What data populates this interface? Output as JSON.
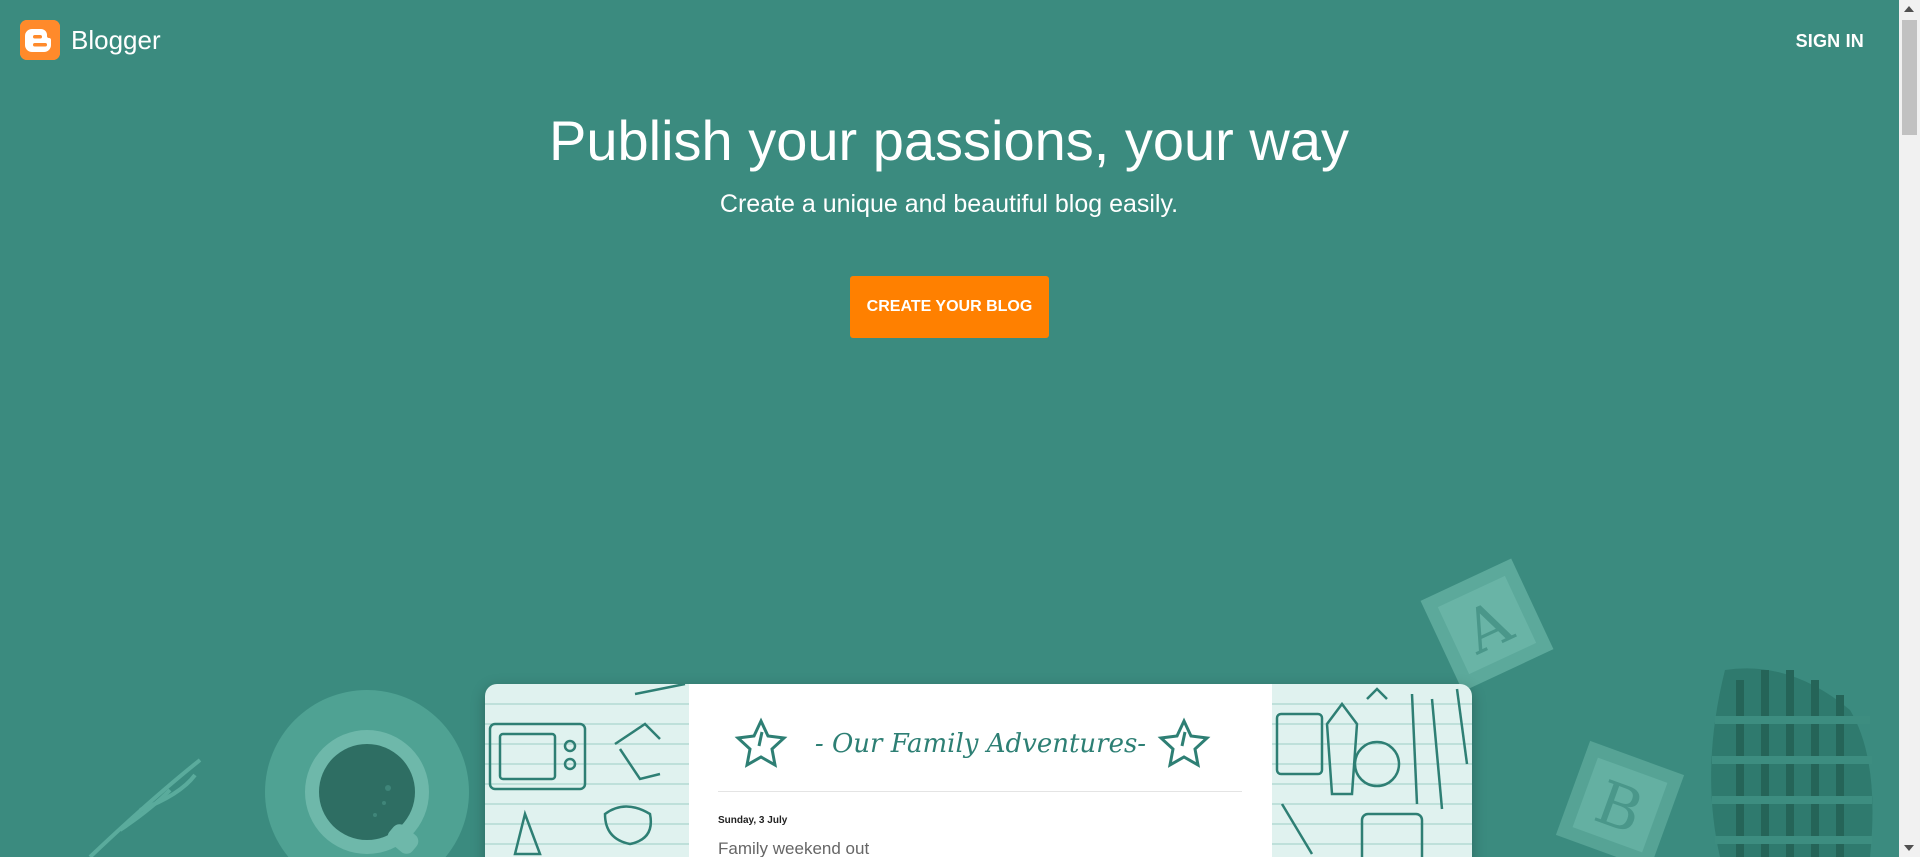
{
  "header": {
    "brand": "Blogger",
    "sign_in": "SIGN IN"
  },
  "hero": {
    "title": "Publish your passions, your way",
    "subtitle": "Create a unique and beautiful blog easily.",
    "cta": "CREATE YOUR BLOG"
  },
  "blog_preview": {
    "title": "- Our Family Adventures-",
    "date": "Sunday, 3 July",
    "post_title": "Family weekend out"
  },
  "colors": {
    "background": "#3b8b7f",
    "accent": "#ff8000",
    "logo": "#ff8a2b"
  }
}
